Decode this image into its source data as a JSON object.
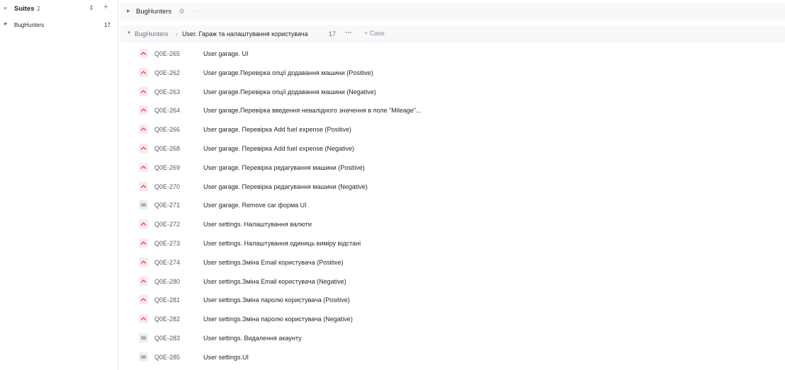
{
  "sidebar": {
    "title": "Suites",
    "count": "2",
    "items": [
      {
        "label": "BugHunters",
        "count": "17"
      }
    ]
  },
  "suite": {
    "title": "BugHunters",
    "count": "0",
    "more": "···"
  },
  "subsuite": {
    "parent": "BugHunters",
    "separator": "›",
    "title": "User. Гараж та налаштування користувача",
    "count": "17",
    "more": "···",
    "add_case_label": "+ Case"
  },
  "priority_colors": {
    "high": "#e5484d",
    "normal": "#6b7280"
  },
  "cases": [
    {
      "id": "Q0E-265",
      "title": "User garage. UI",
      "priority": "high"
    },
    {
      "id": "Q0E-262",
      "title": "User garage.Перевірка опції додавання машини (Positive)",
      "priority": "high"
    },
    {
      "id": "Q0E-263",
      "title": "User garage.Перевірка опції додавання машини (Negative)",
      "priority": "high"
    },
    {
      "id": "Q0E-264",
      "title": "User garage.Перевірка введення невалідного значення в поле \"Mileage\"...",
      "priority": "high"
    },
    {
      "id": "Q0E-266",
      "title": "User garage. Перевірка Add fuel expense (Positive)",
      "priority": "high"
    },
    {
      "id": "Q0E-268",
      "title": "User garage. Перевірка Add fuel expense (Negative)",
      "priority": "high"
    },
    {
      "id": "Q0E-269",
      "title": "User garage. Перевірка редагування машини (Positive)",
      "priority": "high"
    },
    {
      "id": "Q0E-270",
      "title": "User garage. Перевірка редагування машини (Negative)",
      "priority": "high"
    },
    {
      "id": "Q0E-271",
      "title": "User garage. Remove car форма UI",
      "priority": "normal"
    },
    {
      "id": "Q0E-272",
      "title": "User settings. Налаштування валюти",
      "priority": "high"
    },
    {
      "id": "Q0E-273",
      "title": "User settings. Налаштування одиниць виміру відстані",
      "priority": "high"
    },
    {
      "id": "Q0E-274",
      "title": "User settings.Зміна Email користувача (Positive)",
      "priority": "high"
    },
    {
      "id": "Q0E-280",
      "title": "User settings.Зміна Email користувача (Negative)",
      "priority": "high"
    },
    {
      "id": "Q0E-281",
      "title": "User settings.Зміна паролю користувача (Positive)",
      "priority": "high"
    },
    {
      "id": "Q0E-282",
      "title": "User settings.Зміна паролю користувача (Negative)",
      "priority": "high"
    },
    {
      "id": "Q0E-283",
      "title": "User settings. Видалення акаунту",
      "priority": "normal"
    },
    {
      "id": "Q0E-285",
      "title": "User settings.UI",
      "priority": "normal"
    }
  ]
}
